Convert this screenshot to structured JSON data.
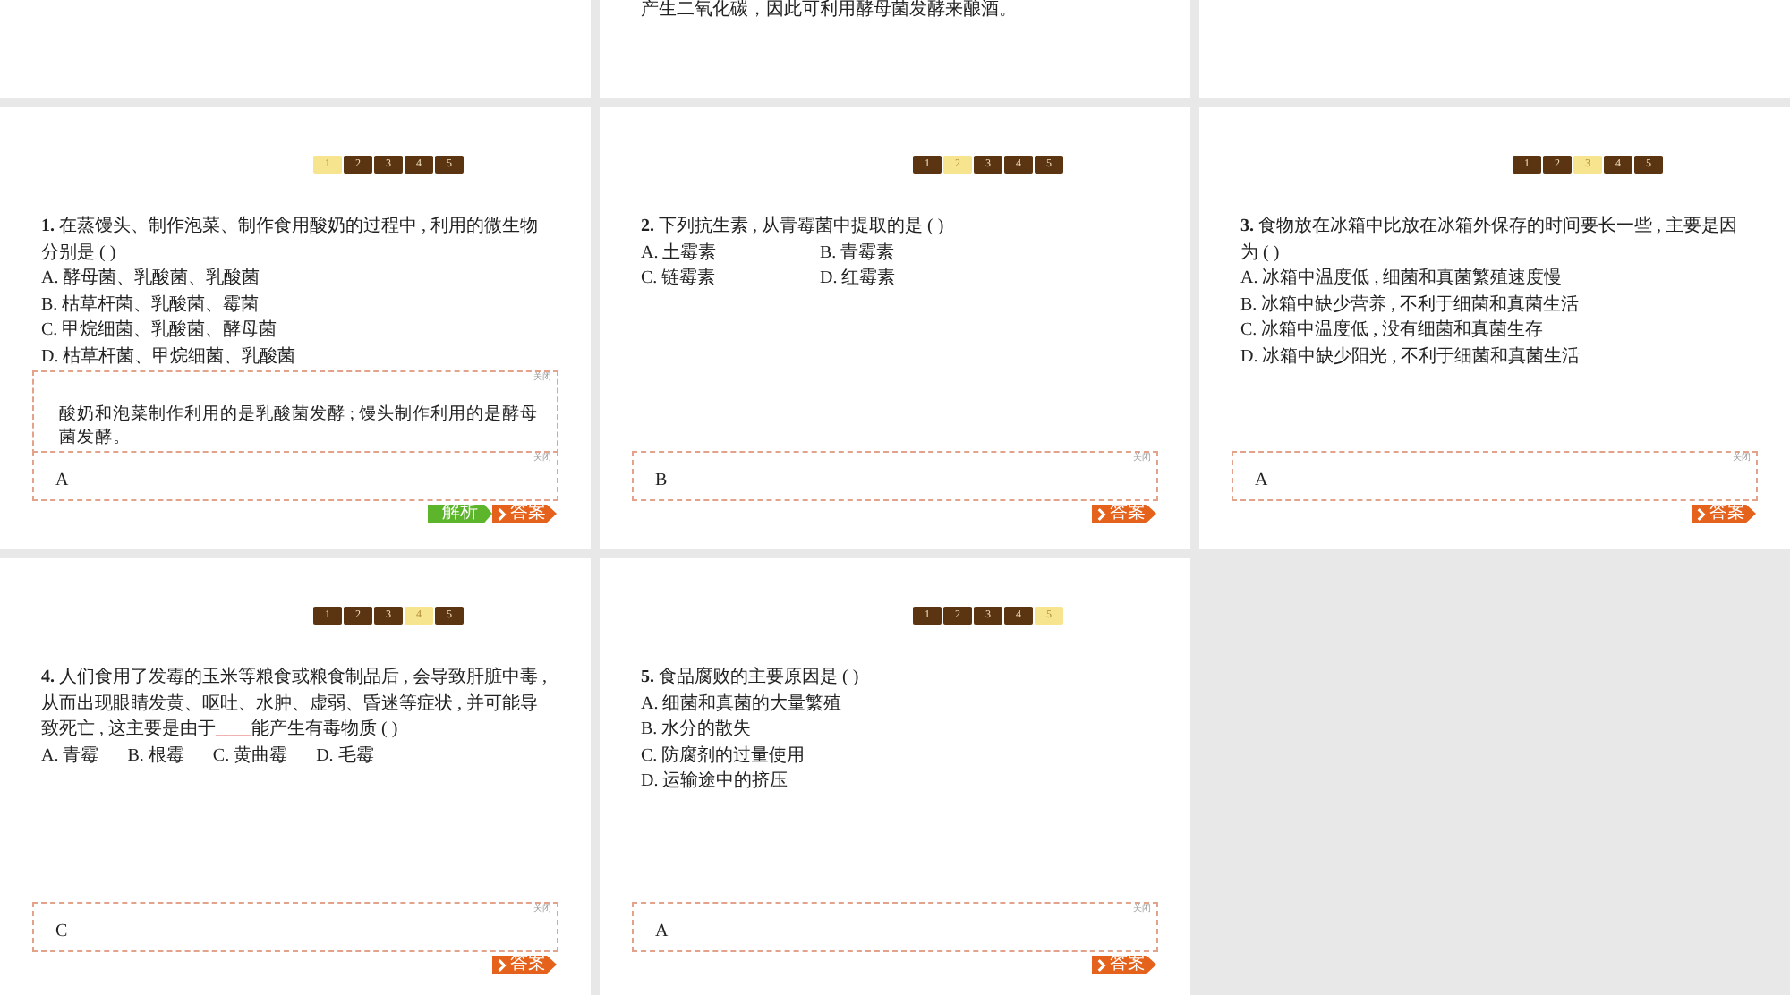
{
  "top_slides": [
    {
      "kind": "empty"
    },
    {
      "kind": "text",
      "text": "产生二氧化碳，因此可利用酵母菌发酵来酿酒。"
    },
    {
      "kind": "empty"
    }
  ],
  "slides": [
    {
      "pager": [
        {
          "label": "1",
          "selected": true
        },
        {
          "label": "2",
          "selected": false
        },
        {
          "label": "3",
          "selected": false
        },
        {
          "label": "4",
          "selected": false
        },
        {
          "label": "5",
          "selected": false
        }
      ],
      "number": "1.",
      "stem": [
        {
          "kind": "text",
          "text": "在蒸馒头、制作泡菜、制作食用酸奶的过程中 , 利用的微生物分别是 ( )"
        }
      ],
      "option_rows": [
        [
          "A. 酵母菌、乳酸菌、乳酸菌"
        ],
        [
          "B. 枯草杆菌、乳酸菌、霉菌"
        ],
        [
          "C. 甲烷细菌、乳酸菌、酵母菌"
        ],
        [
          "D. 枯草杆菌、甲烷细菌、乳酸菌"
        ]
      ],
      "analysis": {
        "close_label": "关闭",
        "text": "酸奶和泡菜制作利用的是乳酸菌发酵 ; 馒头制作利用的是酵母菌发酵。"
      },
      "answer": {
        "close_label": "关闭",
        "text": "A"
      },
      "buttons": [
        {
          "kind": "analysis",
          "label": "解析"
        },
        {
          "kind": "answer",
          "label": "答案"
        }
      ]
    },
    {
      "pager": [
        {
          "label": "1",
          "selected": false
        },
        {
          "label": "2",
          "selected": true
        },
        {
          "label": "3",
          "selected": false
        },
        {
          "label": "4",
          "selected": false
        },
        {
          "label": "5",
          "selected": false
        }
      ],
      "number": "2.",
      "stem": [
        {
          "kind": "text",
          "text": "下列抗生素 , 从青霉菌中提取的是 ( )"
        }
      ],
      "option_rows": [
        [
          "A. 土霉素",
          "B. 青霉素"
        ],
        [
          "C. 链霉素",
          "D. 红霉素"
        ]
      ],
      "answer": {
        "close_label": "关闭",
        "text": "B"
      },
      "buttons": [
        {
          "kind": "answer",
          "label": "答案"
        }
      ]
    },
    {
      "pager": [
        {
          "label": "1",
          "selected": false
        },
        {
          "label": "2",
          "selected": false
        },
        {
          "label": "3",
          "selected": true
        },
        {
          "label": "4",
          "selected": false
        },
        {
          "label": "5",
          "selected": false
        }
      ],
      "number": "3.",
      "stem": [
        {
          "kind": "text",
          "text": "食物放在冰箱中比放在冰箱外保存的时间要长一些 , 主要是因为 ( )"
        }
      ],
      "option_rows": [
        [
          "A. 冰箱中温度低 , 细菌和真菌繁殖速度慢"
        ],
        [
          "B. 冰箱中缺少营养 , 不利于细菌和真菌生活"
        ],
        [
          "C. 冰箱中温度低 , 没有细菌和真菌生存"
        ],
        [
          "D. 冰箱中缺少阳光 , 不利于细菌和真菌生活"
        ]
      ],
      "answer": {
        "close_label": "关闭",
        "text": "A"
      },
      "buttons": [
        {
          "kind": "answer",
          "label": "答案"
        }
      ]
    },
    {
      "pager": [
        {
          "label": "1",
          "selected": false
        },
        {
          "label": "2",
          "selected": false
        },
        {
          "label": "3",
          "selected": false
        },
        {
          "label": "4",
          "selected": true
        },
        {
          "label": "5",
          "selected": false
        }
      ],
      "number": "4.",
      "stem": [
        {
          "kind": "text",
          "text": "人们食用了发霉的玉米等粮食或粮食制品后 , 会导致肝脏中毒 , 从而出现眼睛发黄、呕吐、水肿、虚弱、昏迷等症状 , 并可能导致死亡 , 这主要是由于"
        },
        {
          "kind": "blank",
          "text": "____"
        },
        {
          "kind": "text",
          "text": "能产生有毒物质 ( )"
        }
      ],
      "option_rows": [
        [
          "A. 青霉",
          "B. 根霉",
          "C. 黄曲霉",
          "D. 毛霉"
        ]
      ],
      "answer": {
        "close_label": "关闭",
        "text": "C"
      },
      "buttons": [
        {
          "kind": "answer",
          "label": "答案"
        }
      ]
    },
    {
      "pager": [
        {
          "label": "1",
          "selected": false
        },
        {
          "label": "2",
          "selected": false
        },
        {
          "label": "3",
          "selected": false
        },
        {
          "label": "4",
          "selected": false
        },
        {
          "label": "5",
          "selected": true
        }
      ],
      "number": "5.",
      "stem": [
        {
          "kind": "text",
          "text": "食品腐败的主要原因是 ( )"
        }
      ],
      "option_rows": [
        [
          "A. 细菌和真菌的大量繁殖"
        ],
        [
          "B. 水分的散失"
        ],
        [
          "C. 防腐剂的过量使用"
        ],
        [
          "D. 运输途中的挤压"
        ]
      ],
      "answer": {
        "close_label": "关闭",
        "text": "A"
      },
      "buttons": [
        {
          "kind": "answer",
          "label": "答案"
        }
      ]
    }
  ]
}
